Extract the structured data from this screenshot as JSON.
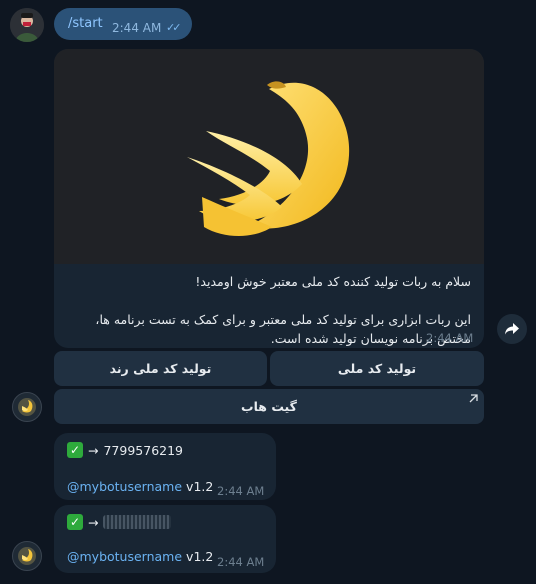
{
  "user_message": {
    "text": "/start",
    "time": "2:44 AM",
    "status": "read"
  },
  "bot_card": {
    "welcome": "سلام به ربات تولید کننده کد ملی معتبر خوش اومدید!",
    "description": "این ربات ابزاری برای تولید کد ملی معتبر و برای کمک به تست برنامه ها، مختص برنامه نویسان تولید شده است.",
    "time": "2:44 AM"
  },
  "keyboard": {
    "generate": "تولید کد ملی",
    "generate_random": "تولید کد ملی رند",
    "github": "گیت هاب"
  },
  "messages": [
    {
      "arrow": "→",
      "code": "7799576219",
      "mention": "@mybotusername",
      "version": "v1.2",
      "time": "2:44 AM"
    },
    {
      "arrow": "→",
      "code": "",
      "mention": "@mybotusername",
      "version": "v1.2",
      "time": "2:44 AM"
    }
  ],
  "icons": {
    "check": "check-mark-button-icon",
    "share": "forward-arrow-icon",
    "external": "external-link-icon",
    "banana": "banana-icon"
  },
  "colors": {
    "background": "#0e1621",
    "outgoing_bubble": "#2b5278",
    "incoming_bubble": "#182533",
    "button": "#203041",
    "link": "#6ab2f2"
  }
}
